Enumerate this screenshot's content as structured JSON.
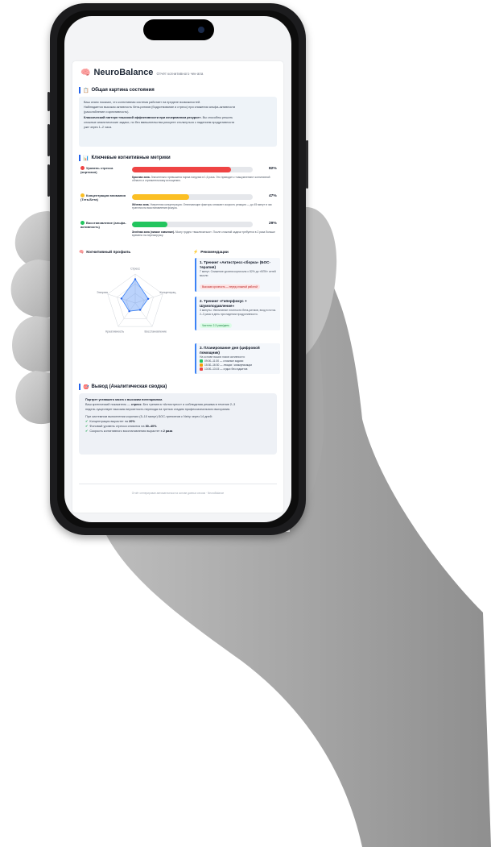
{
  "app": {
    "brand": "NeuroBalance",
    "subtitle": "Отчёт когнитивного чек-апа"
  },
  "overview": {
    "title": "Общая картина состояния",
    "line1": "Ваш сеанс показал, что когнитивная система работает на пределе возможностей.",
    "line2": "Наблюдается высокая активность бета-ритмов (бодрствование и стресс) при снижении альфа-активности",
    "line3": "(расслабление и креативность).",
    "line4_bold": "Классический паттерн «высокой эффективности при исчерпанном ресурсе».",
    "line4_rest": " Вы способны решать",
    "line5": "сложные аналитические задачи, но без вмешательства рискуете столкнуться с падением продуктивности",
    "line6": "уже через 1–2 часа."
  },
  "metrics": {
    "title": "Ключевые когнитивные метрики",
    "items": [
      {
        "label": "Уровень стресса (кортизол)",
        "percent": 82,
        "percent_text": "82%",
        "color": "#ef4444",
        "note_bold": "Красная зона.",
        "note": " Значительно превышена норма нагрузки в 1,6 раза. Это приводит к «зашумлению» когнитивной области и стремительному истощению."
      },
      {
        "label": "Концентрация внимания (Тета-Бета)",
        "percent": 47,
        "percent_text": "47%",
        "color": "#fbbf24",
        "note_bold": "Жёлтая зона.",
        "note": " Умеренная концентрация. Отвлекающие факторы снижают скорость реакции — до 45 минут в час тратится на восстановление фокуса."
      },
      {
        "label": "Восстановление (альфа-активность)",
        "percent": 29,
        "percent_text": "29%",
        "color": "#22c55e",
        "note_bold": "Зелёная зона (низкое значение).",
        "note": " Мозгу трудно «выключаться». После сложной задачи требуется в 2 раза больше времени на перезагрузку."
      }
    ]
  },
  "profile": {
    "title": "Когнитивный профиль",
    "axes": [
      "Стресс",
      "Концентрац.",
      "Восстановление",
      "Креативность",
      "Энергия"
    ],
    "chart_data": {
      "type": "radar",
      "categories": [
        "Стресс",
        "Концентрац.",
        "Восстановление",
        "Креативность",
        "Энергия"
      ],
      "values": [
        82,
        47,
        29,
        35,
        50
      ],
      "range": [
        0,
        100
      ]
    }
  },
  "recommendations": {
    "title": "Рекомендации",
    "cards": [
      {
        "title": "1. Тренинг «Антистресс-сборка» (БОС-терапия)",
        "text": "7 минут. Снижение уровня кортизола с 82% до «ВПК» сетей мысли",
        "badge": "Высокая срочность — перед сложной работой"
      },
      {
        "title": "2. Тренинг «Гиперфокус + Шумоподавление»",
        "text": "3 минуты. Увеличение плотности бета-ритмов, вход в поток. 2–3 раза в день при падении продуктивности.",
        "badge": "Частота: 2-3 раза/день"
      },
      {
        "title": "3. Планирование дня (цифровой помощник)",
        "text": "На основе ваших пиков активности:",
        "items": [
          {
            "icon": "green-square-icon",
            "color": "#22c55e",
            "text": "09:00–11:30 — сложные задачи"
          },
          {
            "icon": "orange-square-icon",
            "color": "#f59e0b",
            "text": "15:30–16:30 — лекции / коммуникации"
          },
          {
            "icon": "red-square-icon",
            "color": "#ef4444",
            "text": "13:00–13:15 — отдых без гаджетов"
          }
        ]
      }
    ]
  },
  "conclusion": {
    "title": "Вывод (Аналитическая сводка)",
    "headline": "Портрет уставшего мозга с высоким потенциалом.",
    "p1_a": "Ваш критический показатель — ",
    "p1_bold": "стресс",
    "p1_b": ". Без тренинга «Антистресс» и соблюдения режима в течение 2–3",
    "p2": "недель существует высокая вероятность перехода на третью стадию профессионального выгорания.",
    "p3": "При системном выполнении коротких (5–10 минут) БОС-тренингов с Neiry через 14 дней:",
    "bullets": [
      {
        "text": "Концентрация вырастет на ",
        "bold": "20%"
      },
      {
        "text": "Фоновый уровень стресса снизится на ",
        "bold": "30–40%"
      },
      {
        "text": "Скорость когнитивного восстановления вырастет в ",
        "bold": "2 раза"
      }
    ]
  },
  "footer": "Отчёт сгенерирован автоматически на основе данных сессии · NeuroBalance",
  "colors": {
    "accent": "#2563eb",
    "stress": "#ef4444",
    "focus": "#fbbf24",
    "recovery": "#22c55e"
  }
}
